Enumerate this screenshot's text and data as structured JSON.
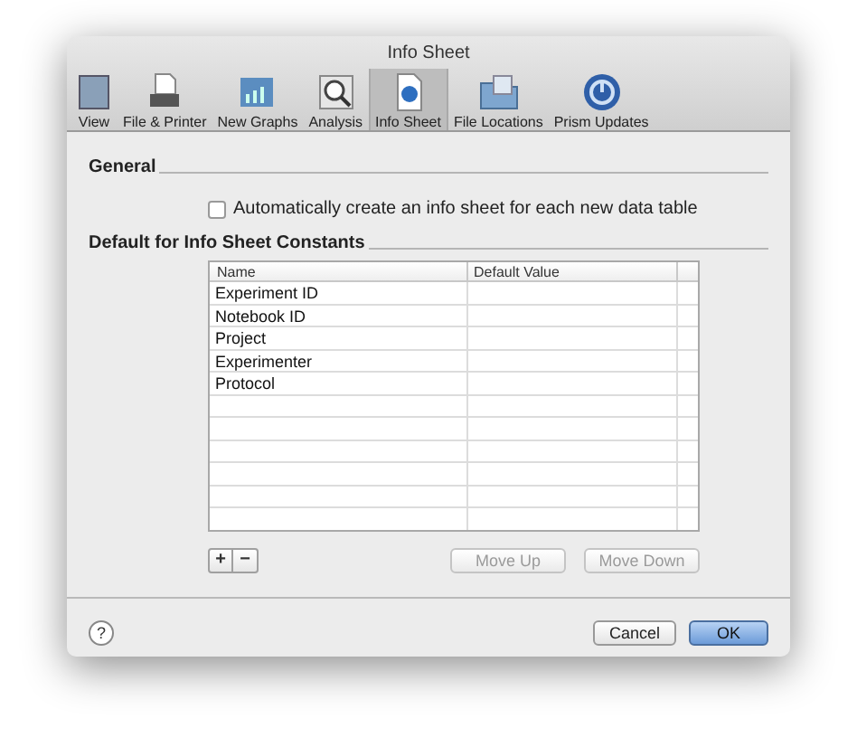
{
  "window": {
    "title": "Info Sheet"
  },
  "toolbar": [
    {
      "label": "View",
      "selected": false
    },
    {
      "label": "File & Printer",
      "selected": false
    },
    {
      "label": "New Graphs",
      "selected": false
    },
    {
      "label": "Analysis",
      "selected": false
    },
    {
      "label": "Info Sheet",
      "selected": true
    },
    {
      "label": "File Locations",
      "selected": false
    },
    {
      "label": "Prism Updates",
      "selected": false
    }
  ],
  "general": {
    "heading": "General",
    "checkbox": {
      "label": "Automatically create an info sheet for each new data table",
      "checked": false
    }
  },
  "constants": {
    "heading": "Default for Info Sheet Constants",
    "table": {
      "columns": [
        "Name",
        "Default Value"
      ],
      "rows": [
        {
          "name": "Experiment ID"
        },
        {
          "name": "Notebook ID"
        },
        {
          "name": "Project"
        },
        {
          "name": "Experimenter"
        },
        {
          "name": "Protocol"
        }
      ]
    },
    "add_button": "+",
    "remove_button": "−",
    "buttons": [
      {
        "label": "Move Up",
        "disabled": true
      },
      {
        "label": "Move Down",
        "disabled": true
      }
    ]
  },
  "footer": {
    "help": "?",
    "cancel": "Cancel",
    "ok": "OK"
  }
}
